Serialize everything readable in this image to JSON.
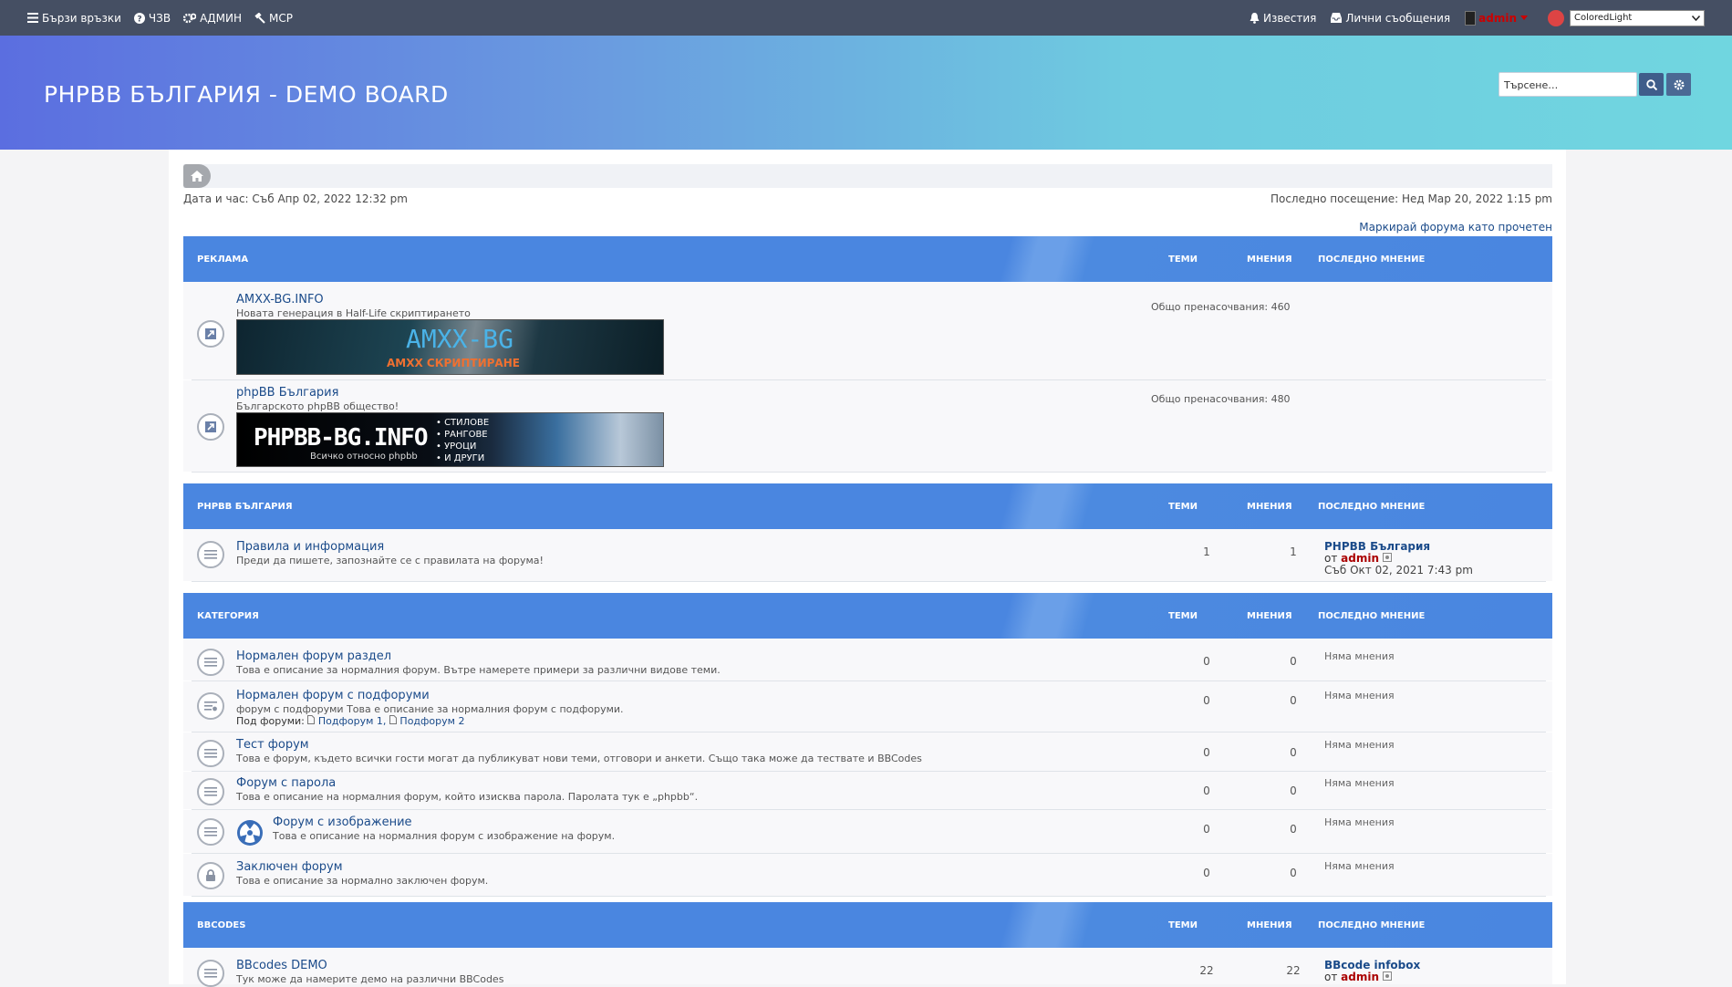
{
  "navbar": {
    "quick_links": "Бързи връзки",
    "faq": "ЧЗВ",
    "admin": "АДМИН",
    "mcp": "МСР",
    "notifications": "Известия",
    "messages": "Лични съобщения",
    "username": "admin",
    "style": "ColoredLight"
  },
  "header": {
    "site_title": "PHPBB БЪЛГАРИЯ - DEMO BOARD",
    "search_placeholder": "Търсене…"
  },
  "meta": {
    "datetime": "Дата и час: Съб Апр 02, 2022 12:32 pm",
    "last_visit": "Последно посещение: Нед Мар 20, 2022 1:15 pm",
    "mark_read": "Маркирай форума като прочетен"
  },
  "columns": {
    "topics": "ТЕМИ",
    "posts": "МНЕНИЯ",
    "last_post": "ПОСЛЕДНО МНЕНИЕ"
  },
  "categories": [
    {
      "title": "РЕКЛАМА",
      "forums": [
        {
          "title": "AMXX-BG.INFO",
          "desc": "Новата генерация в Half-Life скриптирането",
          "redirects": "Общо пренасочвания: 460",
          "banner_title": "AMXX-BG",
          "banner_sub": "AMXX СКРИПТИРАНЕ"
        },
        {
          "title": "phpBB България",
          "desc": "Българското phpBB общество!",
          "redirects": "Общо пренасочвания: 480",
          "banner_title": "PHPBB-BG.INFO",
          "banner_sub": "Всичко относно phpbb",
          "banner_list": [
            "• СТИЛОВЕ",
            "• РАНГОВЕ",
            "• УРОЦИ",
            "• И ДРУГИ"
          ]
        }
      ]
    },
    {
      "title": "PHPBB БЪЛГАРИЯ",
      "forums": [
        {
          "title": "Правила и информация",
          "desc": "Преди да пишете, запознайте се с правилата на форума!",
          "topics": "1",
          "posts": "1",
          "last_title": "PHPBB България",
          "last_by": "от",
          "last_user": "admin",
          "last_date": "Съб Окт 02, 2021 7:43 pm"
        }
      ]
    },
    {
      "title": "КАТЕГОРИЯ",
      "forums": [
        {
          "title": "Нормален форум раздел",
          "desc": "Това е описание за нормалния форум. Вътре намерете примери за различни видове теми.",
          "topics": "0",
          "posts": "0",
          "last": "Няма мнения"
        },
        {
          "title": "Нормален форум с подфоруми",
          "desc": "форум с подфоруми Това е описание за нормалния форум с подфоруми.",
          "subforums_label": "Под форуми:",
          "subforums": [
            "Подфорум 1,",
            "Подфорум 2"
          ],
          "topics": "0",
          "posts": "0",
          "last": "Няма мнения"
        },
        {
          "title": "Тест форум",
          "desc": "Това е форум, където всички гости могат да публикуват нови теми, отговори и анкети. Също така може да тествате и BBCodes",
          "topics": "0",
          "posts": "0",
          "last": "Няма мнения"
        },
        {
          "title": "Форум с парола",
          "desc": "Това е описание на нормалния форум, който изисква парола. Паролата тук е „phpbb“.",
          "topics": "0",
          "posts": "0",
          "last": "Няма мнения"
        },
        {
          "title": "Форум с изображение",
          "desc": "Това е описание на нормалния форум с изображение на форум.",
          "topics": "0",
          "posts": "0",
          "last": "Няма мнения"
        },
        {
          "title": "Заключен форум",
          "desc": "Това е описание за нормално заключен форум.",
          "topics": "0",
          "posts": "0",
          "last": "Няма мнения"
        }
      ]
    },
    {
      "title": "BBCODES",
      "forums": [
        {
          "title": "BBcodes DEMO",
          "desc": "Тук може да намерите демо на различни BBCodes",
          "topics": "22",
          "posts": "22",
          "last_title": "BBcode infobox",
          "last_by": "от",
          "last_user": "admin"
        }
      ]
    }
  ]
}
